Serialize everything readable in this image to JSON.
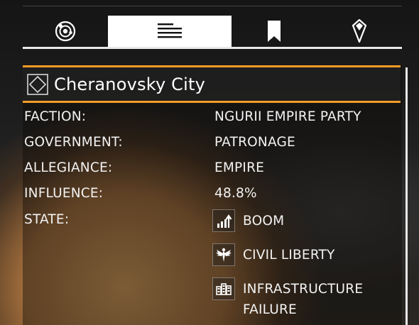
{
  "tabs": [
    {
      "icon": "system-map-icon",
      "selected": false
    },
    {
      "icon": "list-icon",
      "selected": true
    },
    {
      "icon": "bookmark-icon",
      "selected": false
    },
    {
      "icon": "location-pin-icon",
      "selected": false
    }
  ],
  "header": {
    "icon": "faction-diamond-icon",
    "title": "Cheranovsky City"
  },
  "details": {
    "faction_label": "FACTION:",
    "faction_value": "NGURII EMPIRE PARTY",
    "government_label": "GOVERNMENT:",
    "government_value": "PATRONAGE",
    "allegiance_label": "ALLEGIANCE:",
    "allegiance_value": "EMPIRE",
    "influence_label": "INFLUENCE:",
    "influence_value": "48.8%",
    "state_label": "STATE:"
  },
  "states": [
    {
      "icon": "boom-icon",
      "line1": "BOOM",
      "line2": ""
    },
    {
      "icon": "civil-liberty-icon",
      "line1": "CIVIL LIBERTY",
      "line2": ""
    },
    {
      "icon": "infrastructure-failure-icon",
      "line1": "INFRASTRUCTURE",
      "line2": "FAILURE"
    }
  ],
  "colors": {
    "accent": "#f39b28",
    "selected_tab": "#ffffff",
    "text": "#f2f2f2"
  }
}
